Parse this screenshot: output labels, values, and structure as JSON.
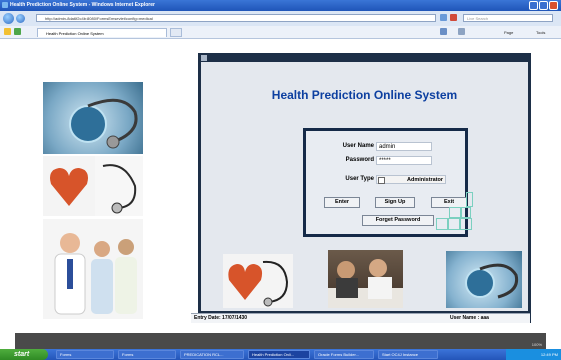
{
  "window": {
    "title": "Health Prediction Online System - Windows Internet Explorer"
  },
  "browser": {
    "address": "http://admin-8da6f2c4b:8080/FormsEmsevlet/config=medical",
    "search_placeholder": "Live Search",
    "tab_title": "Health Prediction Online System",
    "page_menu": "Page",
    "tools_menu": "Tools"
  },
  "app": {
    "title": "Health Prediction Online System",
    "login": {
      "username_label": "User Name",
      "username_value": "admin",
      "password_label": "Password",
      "password_value": "*****",
      "usertype_label": "User Type",
      "usertype_value": "Administrator",
      "enter_button": "Enter",
      "signup_button": "Sign Up",
      "exit_button": "Exit",
      "forget_button": "Forget Password"
    },
    "status": {
      "entry_date": "Entry Date: 17/07/1430",
      "user_name": "User Name : aaa"
    }
  },
  "ie_status": {
    "zoom": "100%"
  },
  "taskbar": {
    "start": "start",
    "tasks": [
      "Forms",
      "Forms",
      "PREDICATION RCL...",
      "Health Prediction Onli...",
      "Oracle Forms Builder...",
      "Start OC4J Instance"
    ],
    "clock": "12:49 PM"
  },
  "colors": {
    "title_blue": "#0c3fa0",
    "app_frame": "#1d2f47",
    "taskbar": "#2455b8",
    "start_green": "#2f8a24"
  }
}
